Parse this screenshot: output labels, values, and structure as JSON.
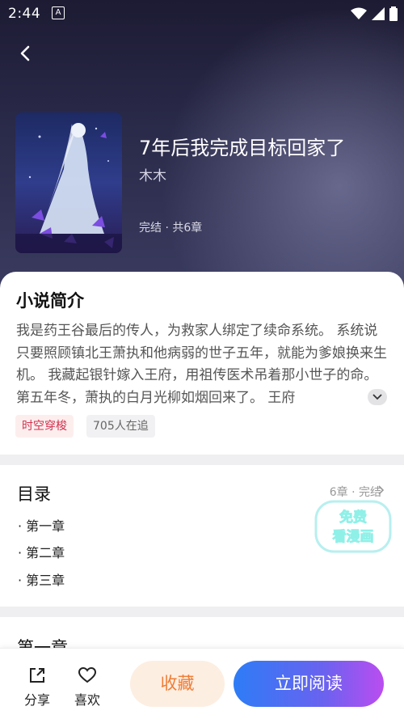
{
  "status_bar": {
    "time": "2:44"
  },
  "book": {
    "title": "7年后我完成目标回家了",
    "author": "木木",
    "status": "完结 · 共6章"
  },
  "intro": {
    "heading": "小说简介",
    "text": "我是药王谷最后的传人，为救家人绑定了续命系统。 系统说只要照顾镇北王萧执和他病弱的世子五年，就能为爹娘换来生机。 我藏起银针嫁入王府，用祖传医术吊着那小世子的命。 第五年冬，萧执的白月光柳如烟回来了。 王府",
    "tags": {
      "genre": "时空穿梭",
      "readers": "705人在追"
    }
  },
  "toc": {
    "heading": "目录",
    "meta": "6章 · 完结",
    "chapters": [
      "· 第一章",
      "· 第二章",
      "· 第三章"
    ]
  },
  "promo": {
    "line1": "免费",
    "line2": "看漫画"
  },
  "chapter_preview": {
    "heading": "第一章"
  },
  "bottom": {
    "share_label": "分享",
    "like_label": "喜欢",
    "favorite_label": "收藏",
    "read_label": "立即阅读"
  },
  "colors": {
    "accent_orange": "#ef7d35",
    "read_gradient_start": "#2d7cf6",
    "read_gradient_end": "#bb4df0",
    "tag_red": "#d0334f"
  }
}
